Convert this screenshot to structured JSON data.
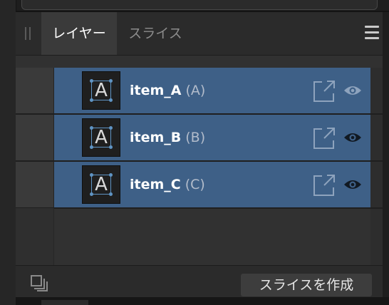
{
  "panel": {
    "tabs": [
      {
        "label": "レイヤー",
        "active": true
      },
      {
        "label": "スライス",
        "active": false
      }
    ],
    "menu_icon": "hamburger-menu-icon"
  },
  "layers": [
    {
      "thumbnail_letter": "A",
      "name": "item_A",
      "tag": "(A)",
      "visible": true,
      "eye_state": "dim"
    },
    {
      "thumbnail_letter": "A",
      "name": "item_B",
      "tag": "(B)",
      "visible": true,
      "eye_state": "dark"
    },
    {
      "thumbnail_letter": "A",
      "name": "item_C",
      "tag": "(C)",
      "visible": true,
      "eye_state": "dark"
    }
  ],
  "footer": {
    "stack_icon": "stack-icon",
    "make_slice_label": "スライスを作成"
  },
  "colors": {
    "selected_row": "#3e6087",
    "frame_accent": "#5f94c4",
    "panel_bg": "#313131"
  }
}
